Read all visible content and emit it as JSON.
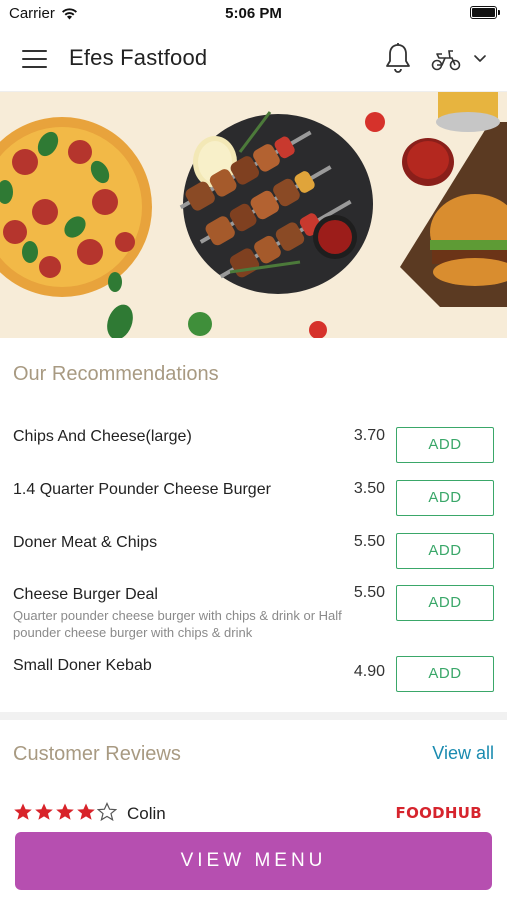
{
  "status_bar": {
    "carrier": "Carrier",
    "time": "5:06 PM",
    "battery_level": 1.0
  },
  "header": {
    "title": "Efes Fastfood",
    "icons": [
      "menu-icon",
      "bell-icon",
      "scooter-icon",
      "chevron-down-icon"
    ]
  },
  "hero": {
    "image": "food-banner"
  },
  "recommendations": {
    "title": "Our Recommendations",
    "add_label": "ADD",
    "items": [
      {
        "name": "Chips And Cheese(large)",
        "price": "3.70",
        "description": ""
      },
      {
        "name": "1.4 Quarter Pounder Cheese Burger",
        "price": "3.50",
        "description": ""
      },
      {
        "name": "Doner Meat & Chips",
        "price": "5.50",
        "description": ""
      },
      {
        "name": "Cheese Burger Deal",
        "price": "5.50",
        "description": "Quarter pounder cheese burger with chips & drink or Half pounder cheese burger with chips & drink"
      },
      {
        "name": "Small Doner Kebab",
        "price": "4.90",
        "description": ""
      }
    ]
  },
  "reviews": {
    "title": "Customer Reviews",
    "view_all": "View all",
    "first_review": {
      "rating": 4,
      "max_rating": 5,
      "reviewer": "Colin",
      "source": "FOODHUB"
    }
  },
  "cta": {
    "label": "VIEW MENU"
  },
  "colors": {
    "accent_green": "#3aa769",
    "cta_purple": "#b64fb0",
    "section_title": "#a89a82",
    "link_blue": "#1a8bb0",
    "star_red": "#d8232a",
    "foodhub_red": "#d6242d"
  }
}
